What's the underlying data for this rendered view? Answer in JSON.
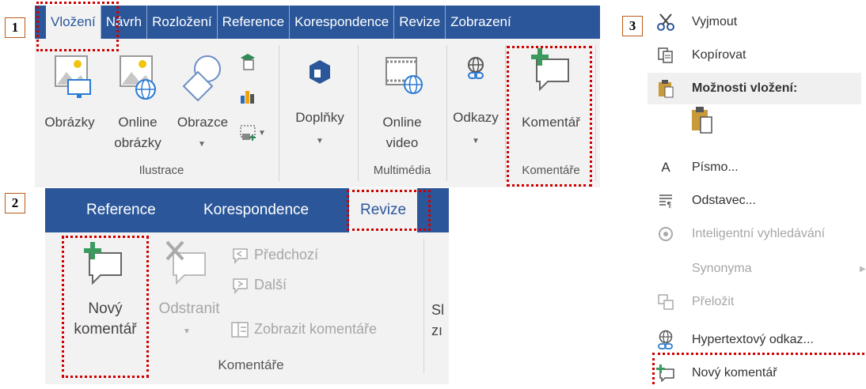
{
  "markers": {
    "m1": "1",
    "m2": "2",
    "m3": "3"
  },
  "ribbon1": {
    "tabs": [
      "Vložení",
      "Návrh",
      "Rozložení",
      "Reference",
      "Korespondence",
      "Revize",
      "Zobrazení"
    ],
    "buttons": {
      "pictures": "Obrázky",
      "online_pictures_1": "Online",
      "online_pictures_2": "obrázky",
      "shapes": "Obrazce",
      "addins": "Doplňky",
      "online_video_1": "Online",
      "online_video_2": "video",
      "links": "Odkazy",
      "comment": "Komentář"
    },
    "groups": {
      "illustrations": "Ilustrace",
      "multimedia": "Multimédia",
      "comments": "Komentáře"
    }
  },
  "ribbon2": {
    "tabs": [
      "Reference",
      "Korespondence",
      "Revize"
    ],
    "buttons": {
      "new_comment_1": "Nový",
      "new_comment_2": "komentář",
      "delete": "Odstranit",
      "previous": "Předchozí",
      "next": "Další",
      "show_comments": "Zobrazit komentáře",
      "cut_off_1": "Sl",
      "cut_off_2": "zı"
    },
    "groups": {
      "comments": "Komentáře"
    }
  },
  "context_menu": {
    "cut": "Vyjmout",
    "copy": "Kopírovat",
    "paste_options": "Možnosti vložení:",
    "font": "Písmo...",
    "paragraph": "Odstavec...",
    "smart_lookup": "Inteligentní vyhledávání",
    "synonyms": "Synonyma",
    "translate": "Přeložit",
    "hyperlink": "Hypertextový odkaz...",
    "new_comment": "Nový komentář"
  },
  "colors": {
    "ribbon_blue": "#2b579a",
    "highlight_red": "#d00000",
    "marker_border": "#b85a17"
  }
}
